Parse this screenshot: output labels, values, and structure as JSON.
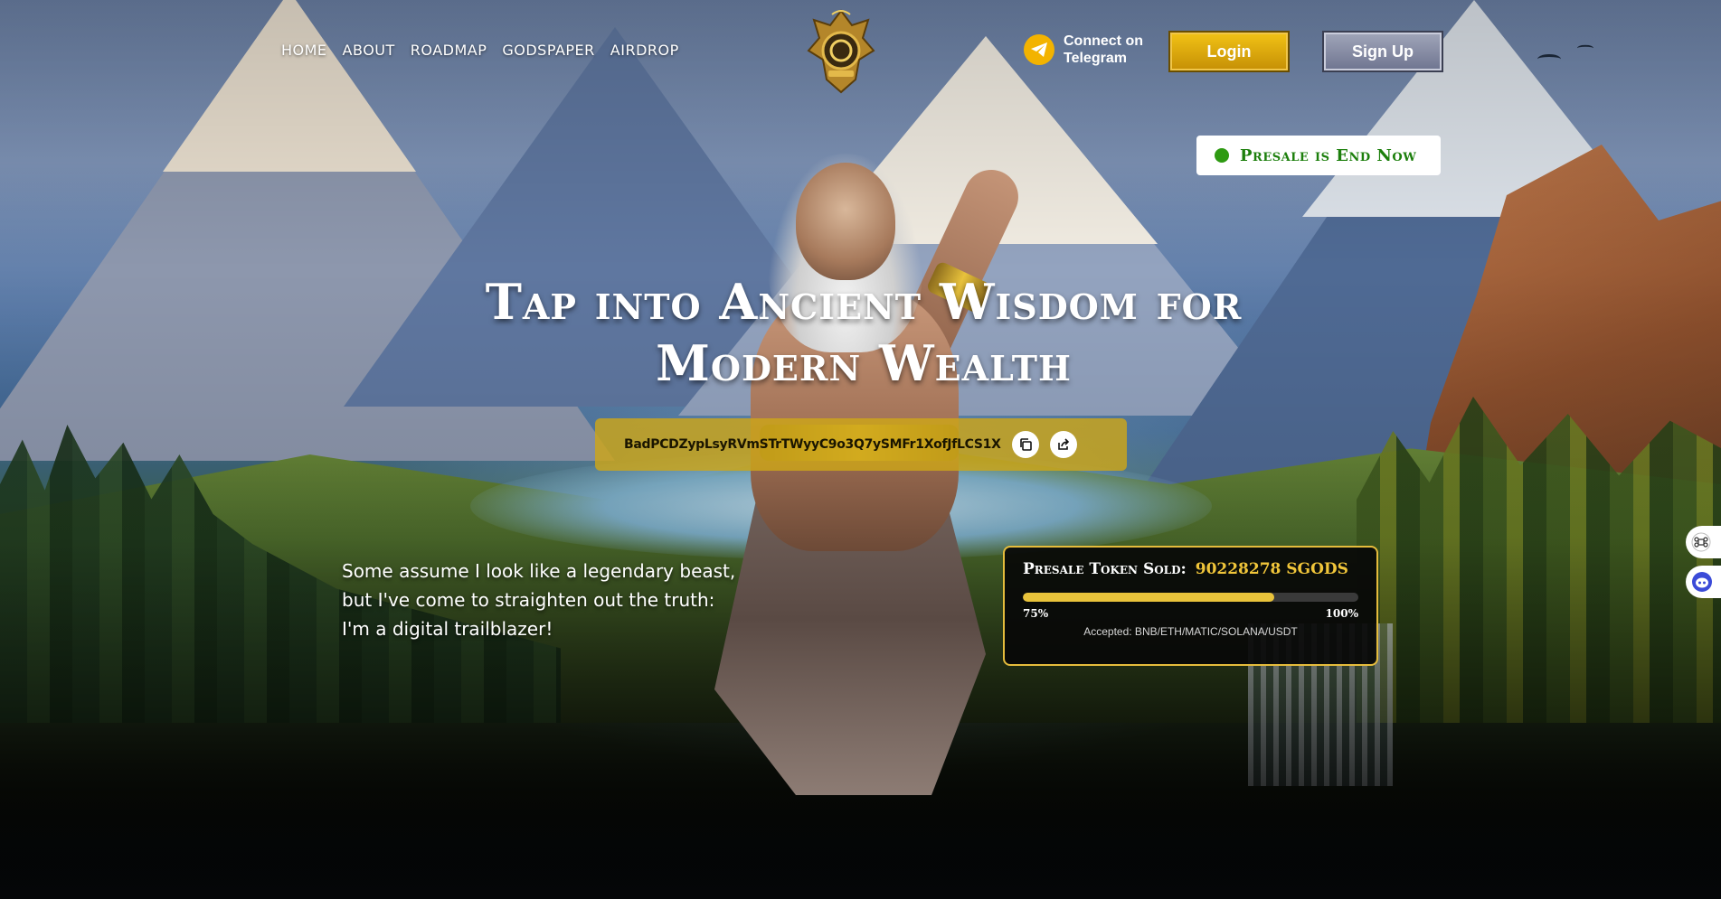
{
  "nav": {
    "items": [
      "HOME",
      "ABOUT",
      "ROADMAP",
      "GODSPAPER",
      "AIRDROP"
    ]
  },
  "header": {
    "telegram_label_line1": "Connect on",
    "telegram_label_line2": "Telegram",
    "login_label": "Login",
    "signup_label": "Sign Up",
    "presale_status": "Presale is End Now"
  },
  "hero": {
    "headline_line1": "Tap into Ancient Wisdom for",
    "headline_line2": "Modern Wealth",
    "contract_address": "BadPCDZypLsyRVmSTrTWyyC9o3Q7ySMFr1XofJfLCS1X",
    "quote_line1": "Some assume I look like a legendary beast,",
    "quote_line2": "but I've come to straighten out the truth:",
    "quote_line3": "I'm a digital trailblazer!"
  },
  "presale_card": {
    "title": "Presale Token Sold:",
    "amount": "90228278 SGODS",
    "progress_percent": 75,
    "label_left": "75%",
    "label_right": "100%",
    "accepted": "Accepted: BNB/ETH/MATIC/SOLANA/USDT"
  },
  "icons": {
    "telegram": "telegram-icon",
    "copy": "copy-icon",
    "share": "share-icon",
    "status_dot": "status-dot-icon",
    "side_widget_1": "command-icon",
    "side_widget_2": "assistant-icon"
  },
  "colors": {
    "accent_gold": "#e9c33b",
    "login_gold": "#f2c316",
    "signup_gray": "#8e93a8",
    "status_green": "#2e9a12"
  }
}
